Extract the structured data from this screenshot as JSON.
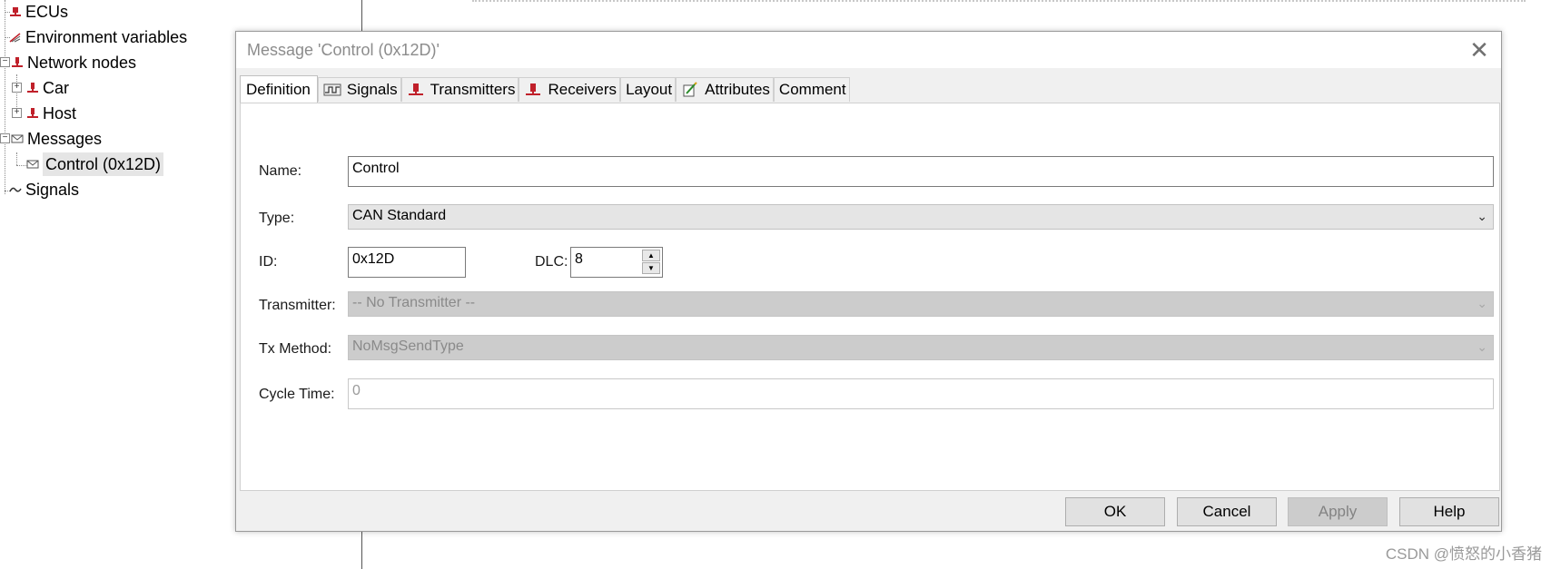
{
  "tree": {
    "items": [
      {
        "label": "ECUs",
        "icon": "ecu-icon"
      },
      {
        "label": "Environment variables",
        "icon": "env-var-icon"
      },
      {
        "label": "Network nodes",
        "icon": "network-node-icon"
      },
      {
        "label": "Car",
        "icon": "network-node-icon"
      },
      {
        "label": "Host",
        "icon": "network-node-icon"
      },
      {
        "label": "Messages",
        "icon": "message-icon"
      },
      {
        "label": "Control (0x12D)",
        "icon": "message-icon"
      },
      {
        "label": "Signals",
        "icon": "signal-icon"
      }
    ]
  },
  "dialog": {
    "title": "Message 'Control (0x12D)'",
    "close_symbol": "✕",
    "tabs": [
      {
        "label": "Definition",
        "icon": ""
      },
      {
        "label": "Signals",
        "icon": "signal-wave-icon"
      },
      {
        "label": "Transmitters",
        "icon": "network-node-icon"
      },
      {
        "label": "Receivers",
        "icon": "network-node-icon"
      },
      {
        "label": "Layout",
        "icon": ""
      },
      {
        "label": "Attributes",
        "icon": "attributes-icon"
      },
      {
        "label": "Comment",
        "icon": ""
      }
    ],
    "form": {
      "name_label": "Name:",
      "name_value": "Control",
      "type_label": "Type:",
      "type_value": "CAN Standard",
      "id_label": "ID:",
      "id_value": "0x12D",
      "dlc_label": "DLC:",
      "dlc_value": "8",
      "transmitter_label": "Transmitter:",
      "transmitter_value": "-- No Transmitter --",
      "tx_method_label": "Tx Method:",
      "tx_method_value": "NoMsgSendType",
      "cycle_time_label": "Cycle Time:",
      "cycle_time_value": "0"
    },
    "buttons": {
      "ok": "OK",
      "cancel": "Cancel",
      "apply": "Apply",
      "help": "Help"
    }
  },
  "watermark": "CSDN @愤怒的小香猪",
  "colors": {
    "node_icon": "#c0202a",
    "dialog_bg": "#f0f0f0",
    "disabled_bg": "#cccccc"
  }
}
